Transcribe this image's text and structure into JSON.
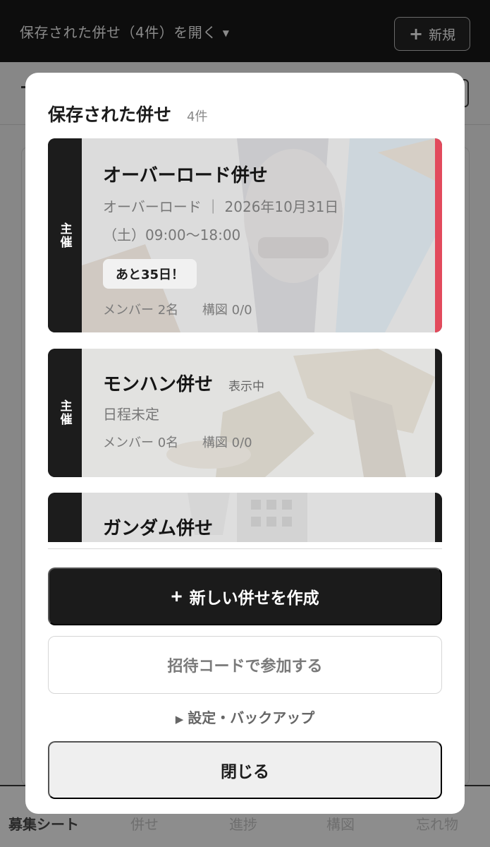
{
  "topbar": {
    "title": "保存された併せ（4件）を開く",
    "new_label": "新規"
  },
  "bottom_nav": {
    "items": [
      "募集シート",
      "併せ",
      "進捗",
      "構図",
      "忘れ物"
    ]
  },
  "modal": {
    "title": "保存された併せ",
    "count": "4件",
    "cards": [
      {
        "tag": "主催",
        "title": "オーバーロード併せ",
        "subtitle_line1": "オーバーロード ｜ 2026年10月31日",
        "subtitle_line2": "（土）09:00〜18:00",
        "countdown": "あと35日！",
        "members": "メンバー 2名",
        "composition": "構図 0/0",
        "accent": "#e24a5c"
      },
      {
        "tag": "主催",
        "title": "モンハン併せ",
        "state": "表示中",
        "subtitle_line1": "日程未定",
        "members": "メンバー 0名",
        "composition": "構図 0/0",
        "accent": "#1b1b1b"
      },
      {
        "tag": "",
        "title": "ガンダム併せ",
        "accent": "#1b1b1b"
      }
    ],
    "create_label": "新しい併せを作成",
    "join_label": "招待コードで参加する",
    "settings_label": "設定・バックアップ",
    "close_label": "閉じる"
  },
  "colors": {
    "overlay": "#8d8d8d",
    "primary": "#1b1b1b",
    "accent_red": "#e24a5c"
  },
  "icons": {
    "new_plus": "plus-icon",
    "caret": "caret-down-icon",
    "settings_arrow": "triangle-right-icon"
  }
}
